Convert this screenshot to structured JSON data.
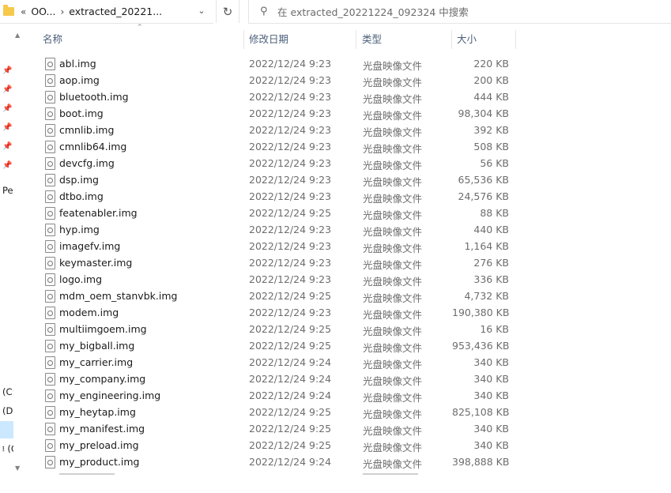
{
  "address": {
    "overflow": "«",
    "crumbs": [
      "OO...",
      "extracted_20221..."
    ],
    "separator": "›",
    "dropdown_icon": "chevron-down-icon",
    "refresh_icon": "refresh-icon"
  },
  "search": {
    "placeholder": "在 extracted_20221224_092324 中搜索",
    "icon": "search-icon"
  },
  "nav": {
    "pinned_count": 6,
    "label_pe": "Pe",
    "drive_c": "(C:",
    "drive_d": "(D:",
    "drive_g": "፧ (G"
  },
  "columns": {
    "name": "名称",
    "date": "修改日期",
    "type": "类型",
    "size": "大小"
  },
  "files": [
    {
      "name": "abl.img",
      "date": "2022/12/24 9:23",
      "type": "光盘映像文件",
      "size": "220 KB"
    },
    {
      "name": "aop.img",
      "date": "2022/12/24 9:23",
      "type": "光盘映像文件",
      "size": "200 KB"
    },
    {
      "name": "bluetooth.img",
      "date": "2022/12/24 9:23",
      "type": "光盘映像文件",
      "size": "444 KB"
    },
    {
      "name": "boot.img",
      "date": "2022/12/24 9:23",
      "type": "光盘映像文件",
      "size": "98,304 KB"
    },
    {
      "name": "cmnlib.img",
      "date": "2022/12/24 9:23",
      "type": "光盘映像文件",
      "size": "392 KB"
    },
    {
      "name": "cmnlib64.img",
      "date": "2022/12/24 9:23",
      "type": "光盘映像文件",
      "size": "508 KB"
    },
    {
      "name": "devcfg.img",
      "date": "2022/12/24 9:23",
      "type": "光盘映像文件",
      "size": "56 KB"
    },
    {
      "name": "dsp.img",
      "date": "2022/12/24 9:23",
      "type": "光盘映像文件",
      "size": "65,536 KB"
    },
    {
      "name": "dtbo.img",
      "date": "2022/12/24 9:23",
      "type": "光盘映像文件",
      "size": "24,576 KB"
    },
    {
      "name": "featenabler.img",
      "date": "2022/12/24 9:25",
      "type": "光盘映像文件",
      "size": "88 KB"
    },
    {
      "name": "hyp.img",
      "date": "2022/12/24 9:23",
      "type": "光盘映像文件",
      "size": "440 KB"
    },
    {
      "name": "imagefv.img",
      "date": "2022/12/24 9:23",
      "type": "光盘映像文件",
      "size": "1,164 KB"
    },
    {
      "name": "keymaster.img",
      "date": "2022/12/24 9:23",
      "type": "光盘映像文件",
      "size": "276 KB"
    },
    {
      "name": "logo.img",
      "date": "2022/12/24 9:23",
      "type": "光盘映像文件",
      "size": "336 KB"
    },
    {
      "name": "mdm_oem_stanvbk.img",
      "date": "2022/12/24 9:25",
      "type": "光盘映像文件",
      "size": "4,732 KB"
    },
    {
      "name": "modem.img",
      "date": "2022/12/24 9:23",
      "type": "光盘映像文件",
      "size": "190,380 KB"
    },
    {
      "name": "multiimgoem.img",
      "date": "2022/12/24 9:25",
      "type": "光盘映像文件",
      "size": "16 KB"
    },
    {
      "name": "my_bigball.img",
      "date": "2022/12/24 9:25",
      "type": "光盘映像文件",
      "size": "953,436 KB"
    },
    {
      "name": "my_carrier.img",
      "date": "2022/12/24 9:24",
      "type": "光盘映像文件",
      "size": "340 KB"
    },
    {
      "name": "my_company.img",
      "date": "2022/12/24 9:24",
      "type": "光盘映像文件",
      "size": "340 KB"
    },
    {
      "name": "my_engineering.img",
      "date": "2022/12/24 9:24",
      "type": "光盘映像文件",
      "size": "340 KB"
    },
    {
      "name": "my_heytap.img",
      "date": "2022/12/24 9:25",
      "type": "光盘映像文件",
      "size": "825,108 KB"
    },
    {
      "name": "my_manifest.img",
      "date": "2022/12/24 9:25",
      "type": "光盘映像文件",
      "size": "340 KB"
    },
    {
      "name": "my_preload.img",
      "date": "2022/12/24 9:25",
      "type": "光盘映像文件",
      "size": "340 KB"
    },
    {
      "name": "my_product.img",
      "date": "2022/12/24 9:24",
      "type": "光盘映像文件",
      "size": "398,888 KB"
    }
  ]
}
